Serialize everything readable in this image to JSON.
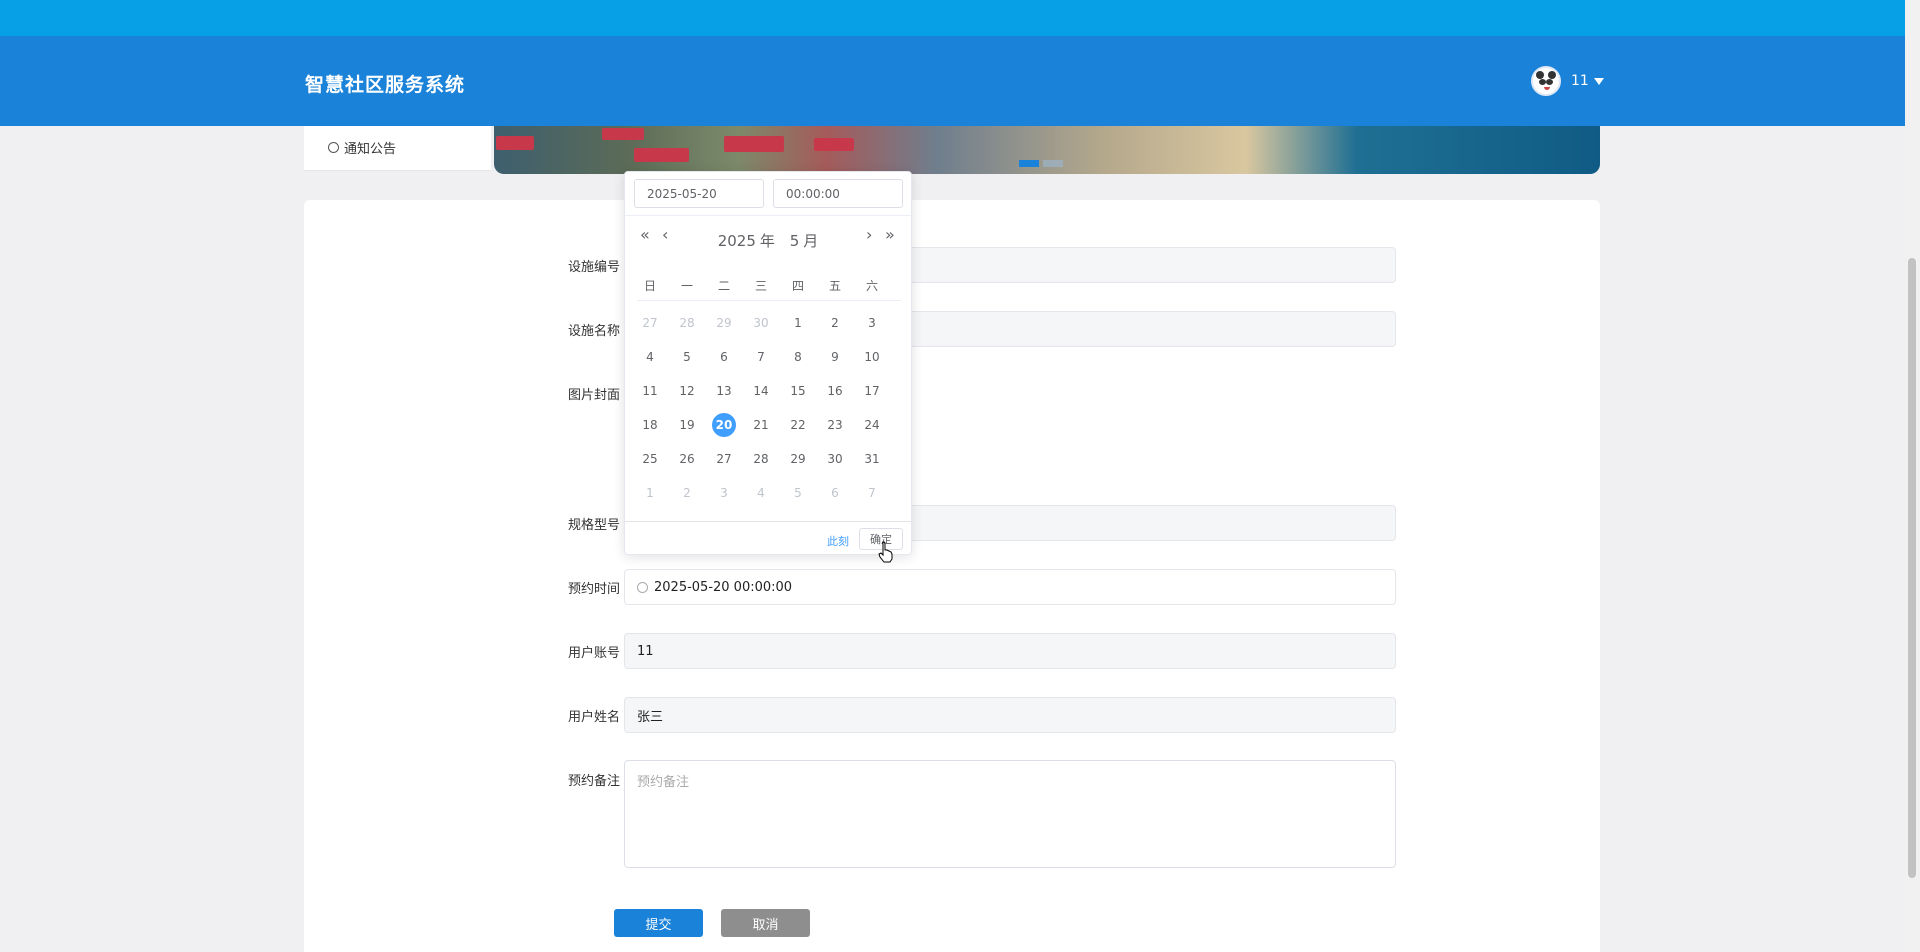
{
  "header": {
    "title": "智慧社区服务系统",
    "user_name": "11"
  },
  "sidebar": {
    "items": [
      {
        "label": "通知公告"
      }
    ]
  },
  "form": {
    "fields": [
      {
        "label": "设施编号",
        "value": ""
      },
      {
        "label": "设施名称",
        "value": ""
      },
      {
        "label": "图片封面"
      },
      {
        "label": "规格型号",
        "value": ""
      },
      {
        "label": "预约时间",
        "value": "2025-05-20 00:00:00"
      },
      {
        "label": "用户账号",
        "value": "11"
      },
      {
        "label": "用户姓名",
        "value": "张三"
      },
      {
        "label": "预约备注",
        "placeholder": "预约备注"
      }
    ],
    "submit_label": "提交",
    "cancel_label": "取消"
  },
  "picker": {
    "date_value": "2025-05-20",
    "time_value": "00:00:00",
    "year": "2025",
    "year_unit": "年",
    "month": "5",
    "month_unit": "月",
    "weekdays": [
      "日",
      "一",
      "二",
      "三",
      "四",
      "五",
      "六"
    ],
    "days": [
      [
        "27",
        "28",
        "29",
        "30",
        "1",
        "2",
        "3"
      ],
      [
        "4",
        "5",
        "6",
        "7",
        "8",
        "9",
        "10"
      ],
      [
        "11",
        "12",
        "13",
        "14",
        "15",
        "16",
        "17"
      ],
      [
        "18",
        "19",
        "20",
        "21",
        "22",
        "23",
        "24"
      ],
      [
        "25",
        "26",
        "27",
        "28",
        "29",
        "30",
        "31"
      ],
      [
        "1",
        "2",
        "3",
        "4",
        "5",
        "6",
        "7"
      ]
    ],
    "now_label": "此刻",
    "confirm_label": "确定"
  },
  "colors": {
    "primary": "#1a82d8",
    "top_strip": "#079fe6",
    "selected_day": "#409eff"
  }
}
